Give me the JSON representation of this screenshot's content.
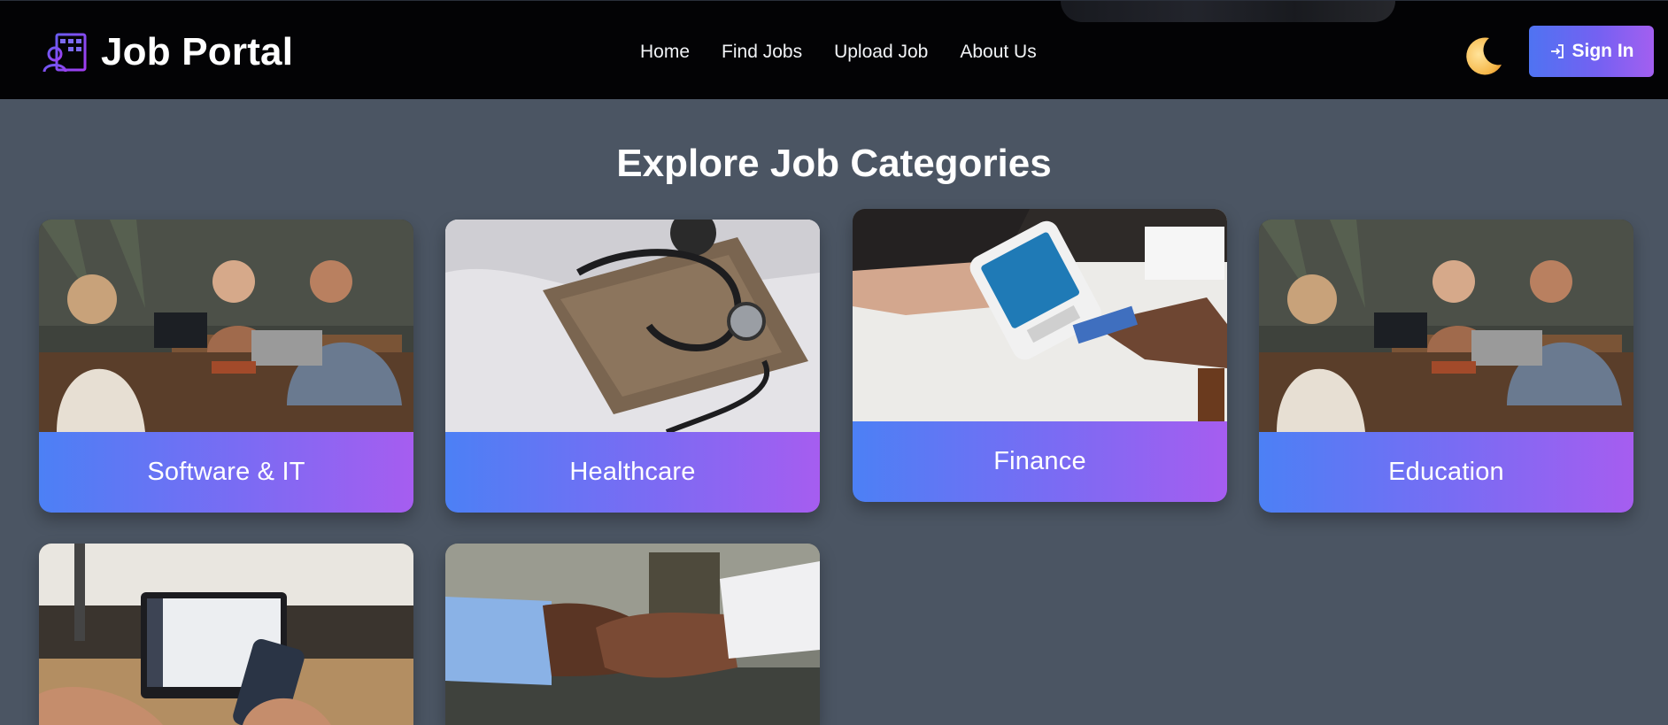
{
  "header": {
    "brand_name": "Job Portal",
    "nav": [
      "Home",
      "Find Jobs",
      "Upload Job",
      "About Us"
    ],
    "theme_toggle_icon": "moon-icon",
    "signin_label": "Sign In",
    "signin_icon": "sign-in-icon"
  },
  "section": {
    "title": "Explore Job Categories"
  },
  "categories": [
    {
      "label": "Software & IT",
      "image": "coworkers-laptops-cafe-photo"
    },
    {
      "label": "Healthcare",
      "image": "stethoscope-photo"
    },
    {
      "label": "Finance",
      "image": "card-payment-terminal-photo"
    },
    {
      "label": "Education",
      "image": "coworkers-laptops-cafe-photo"
    },
    {
      "label": "",
      "image": "laptop-phone-desk-photo"
    },
    {
      "label": "",
      "image": "handshake-photo"
    }
  ],
  "colors": {
    "page_bg": "#4b5563",
    "header_bg": "#030305",
    "accent_gradient_start": "#4c80f5",
    "accent_gradient_end": "#a65df0"
  }
}
